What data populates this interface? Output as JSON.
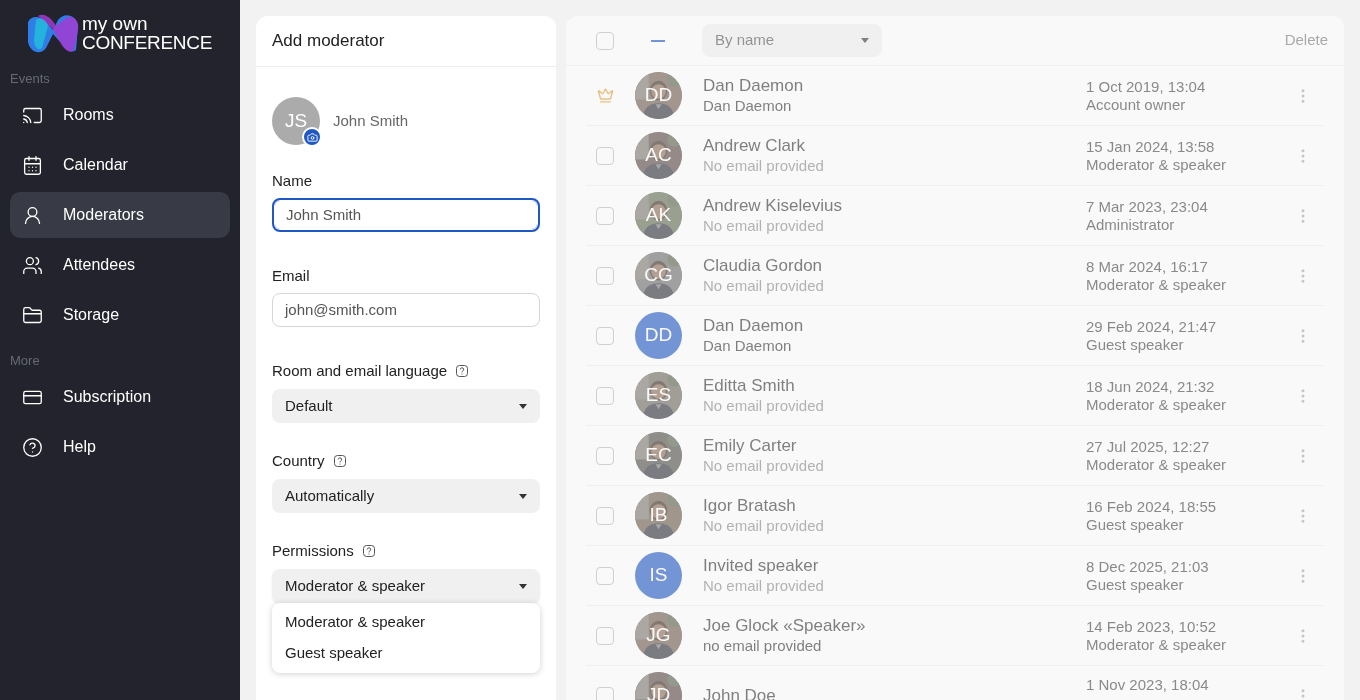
{
  "logo": {
    "line_1": "my own",
    "line_2": "CONFERENCE"
  },
  "sidebar": {
    "sections": [
      {
        "title": "Events",
        "items": [
          {
            "label": "Rooms",
            "selected": false
          },
          {
            "label": "Calendar",
            "selected": false
          },
          {
            "label": "Moderators",
            "selected": true
          },
          {
            "label": "Attendees",
            "selected": false
          },
          {
            "label": "Storage",
            "selected": false
          }
        ]
      },
      {
        "title": "More",
        "items": [
          {
            "label": "Subscription",
            "selected": false
          },
          {
            "label": "Help",
            "selected": false
          }
        ]
      }
    ]
  },
  "form": {
    "title": "Add moderator",
    "avatar": {
      "initials": "JS",
      "name": "John Smith"
    },
    "fields": [
      {
        "kind": "text",
        "label": "Name",
        "value": "John Smith",
        "focused": true,
        "help": false
      },
      {
        "kind": "text",
        "label": "Email",
        "value": "john@smith.com",
        "focused": false,
        "help": false
      },
      {
        "kind": "select",
        "label": "Room and email language",
        "value": "Default",
        "help": true,
        "expanded": false
      },
      {
        "kind": "select",
        "label": "Country",
        "value": "Automatically",
        "help": true,
        "expanded": false
      },
      {
        "kind": "select",
        "label": "Permissions",
        "value": "Moderator & speaker",
        "help": true,
        "expanded": true,
        "options": [
          "Moderator & speaker",
          "Guest speaker"
        ]
      }
    ]
  },
  "list": {
    "dimmed": true,
    "sort": "By name",
    "delete_label": "Delete",
    "rows": [
      {
        "owner": true,
        "initials": "DD",
        "name": "Dan Daemon",
        "subtitle": "Dan Daemon",
        "subtitle_faint": false,
        "date": "1 Oct 2019, 13:04",
        "role": "Account owner"
      },
      {
        "owner": false,
        "initials": "AC",
        "name": "Andrew Clark",
        "subtitle": "No email provided",
        "subtitle_faint": true,
        "date": "15 Jan 2024, 13:58",
        "role": "Moderator & speaker"
      },
      {
        "owner": false,
        "initials": "AK",
        "name": "Andrew Kiselevius",
        "subtitle": "No email provided",
        "subtitle_faint": true,
        "date": "7 Mar 2023, 23:04",
        "role": "Administrator"
      },
      {
        "owner": false,
        "initials": "CG",
        "name": "Claudia Gordon",
        "subtitle": "No email provided",
        "subtitle_faint": true,
        "date": "8 Mar 2024, 16:17",
        "role": "Moderator & speaker"
      },
      {
        "owner": false,
        "kind": "plain",
        "initials": "DD",
        "name": "Dan Daemon",
        "subtitle": "Dan Daemon",
        "subtitle_faint": false,
        "date": "29 Feb 2024, 21:47",
        "role": "Guest speaker"
      },
      {
        "owner": false,
        "initials": "ES",
        "name": "Editta Smith",
        "subtitle": "No email provided",
        "subtitle_faint": true,
        "date": "18 Jun 2024, 21:32",
        "role": "Moderator & speaker"
      },
      {
        "owner": false,
        "initials": "EC",
        "name": "Emily Carter",
        "subtitle": "No email provided",
        "subtitle_faint": true,
        "date": "27 Jul 2025, 12:27",
        "role": "Moderator & speaker"
      },
      {
        "owner": false,
        "initials": "IB",
        "name": "Igor Bratash",
        "subtitle": "No email provided",
        "subtitle_faint": true,
        "date": "16 Feb 2024, 18:55",
        "role": "Guest speaker"
      },
      {
        "owner": false,
        "kind": "plain",
        "initials": "IS",
        "name": "Invited speaker",
        "subtitle": "No email provided",
        "subtitle_faint": true,
        "date": "8 Dec 2025, 21:03",
        "role": "Guest speaker"
      },
      {
        "owner": false,
        "initials": "JG",
        "name": "Joe Glock «Speaker»",
        "subtitle": "no email provided",
        "subtitle_faint": false,
        "date": "14 Feb 2023, 10:52",
        "role": "Moderator & speaker"
      },
      {
        "owner": false,
        "initials": "JD",
        "name": "John Doe",
        "date": "1 Nov 2023, 18:04"
      }
    ]
  }
}
